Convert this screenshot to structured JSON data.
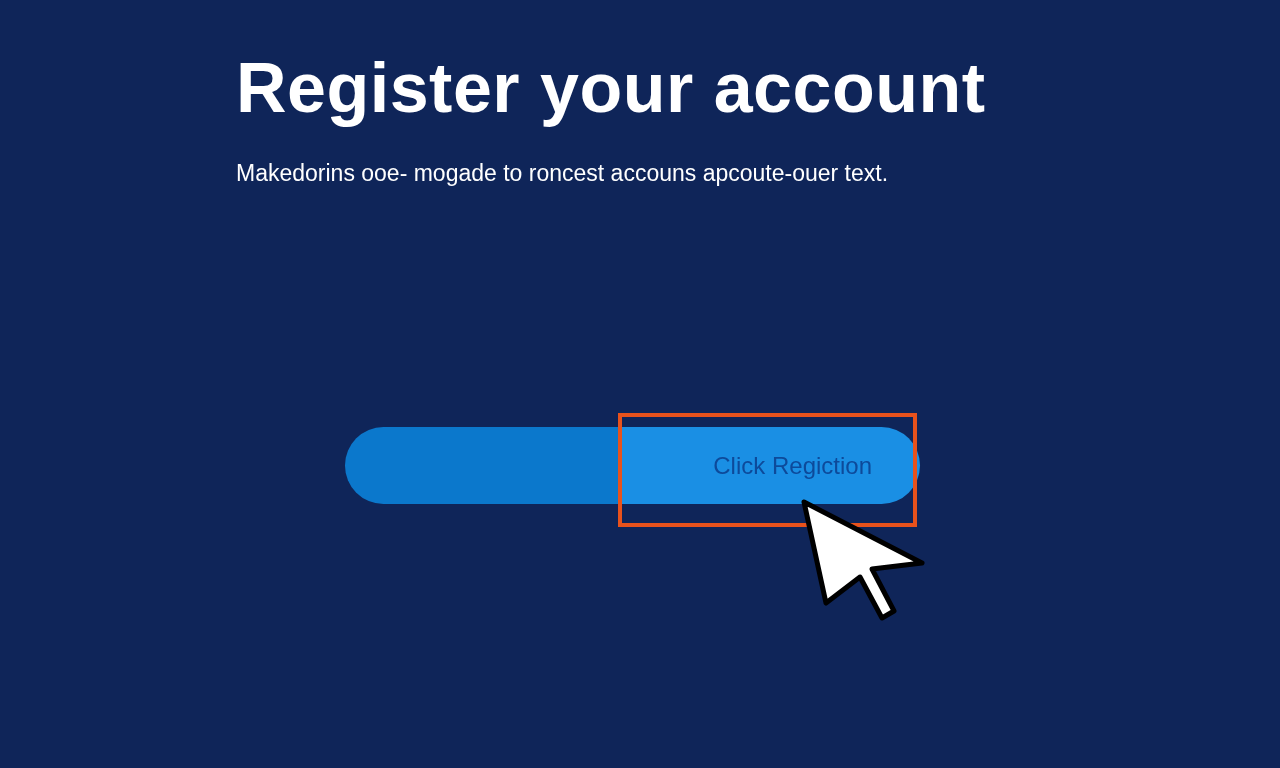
{
  "heading": "Register your account",
  "subtitle": "Makedorins ooe- mogade to roncest accouns apcoute-ouer text.",
  "button": {
    "label": "Click Regiction",
    "highlighted": true
  }
}
